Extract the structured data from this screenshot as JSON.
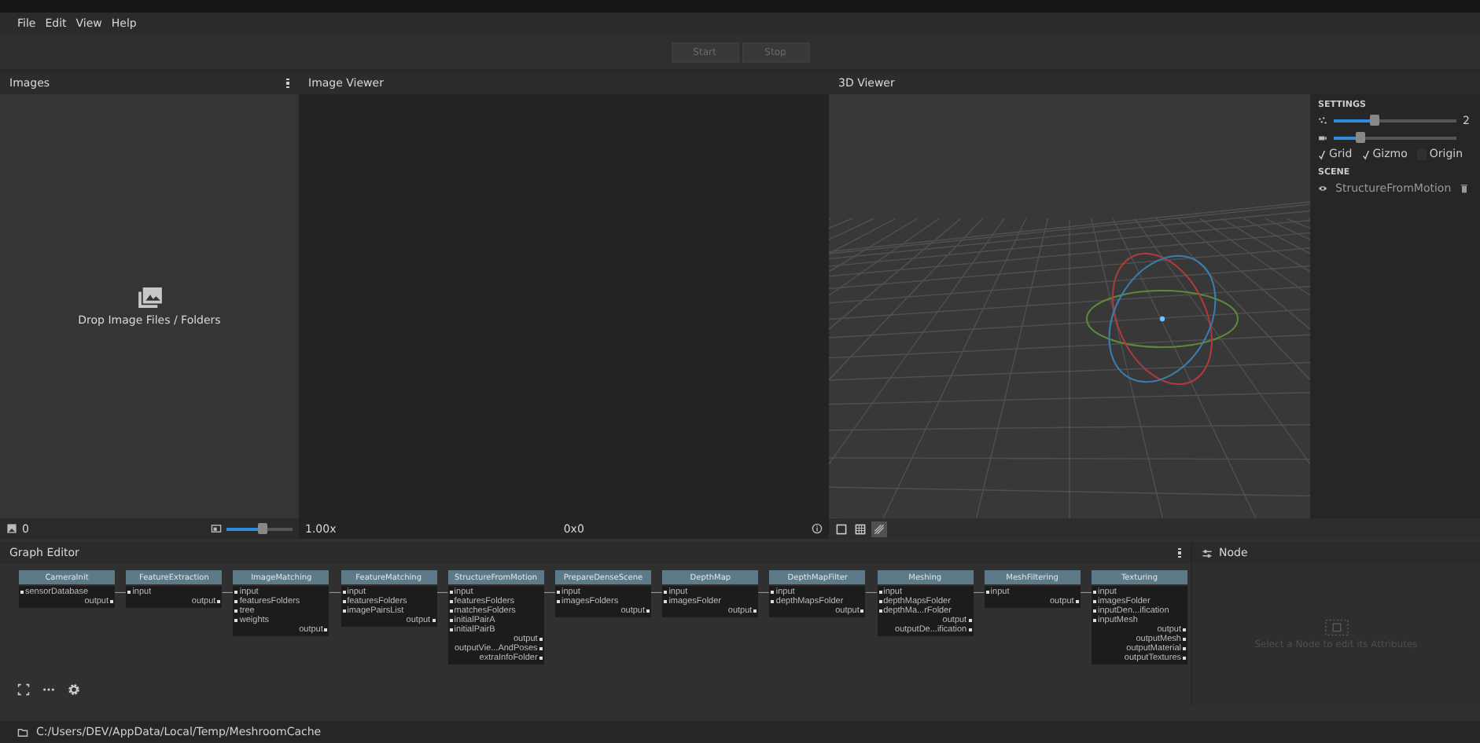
{
  "menu": [
    "File",
    "Edit",
    "View",
    "Help"
  ],
  "toolbar": [
    {
      "label": "Start",
      "disabled": true
    },
    {
      "label": "Stop",
      "disabled": true
    }
  ],
  "images_panel": {
    "title": "Images",
    "drop_hint": "Drop Image Files / Folders",
    "count": "0",
    "thumbnail_size": {
      "level": 0.55
    }
  },
  "image_viewer": {
    "title": "Image Viewer",
    "zoom": "1.00x",
    "resolution": "0x0"
  },
  "viewer_3d": {
    "title": "3D Viewer",
    "settings": {
      "title": "SETTINGS",
      "sliders": [
        {
          "kind": "points",
          "level": 0.33,
          "value": "2"
        },
        {
          "kind": "camera",
          "level": 0.22
        }
      ],
      "toggles": [
        {
          "label": "Grid",
          "checked": true
        },
        {
          "label": "Gizmo",
          "checked": true
        },
        {
          "label": "Origin",
          "checked": false
        }
      ],
      "scene_title": "SCENE",
      "scene_items": [
        {
          "label": "StructureFromMotion",
          "visible": true
        }
      ]
    },
    "view_modes": [
      {
        "kind": "solid",
        "selected": false
      },
      {
        "kind": "wireframe",
        "selected": false
      },
      {
        "kind": "textured",
        "selected": true
      }
    ]
  },
  "graph_editor": {
    "title": "Graph Editor",
    "nodes": [
      {
        "title": "CameraInit",
        "inputs": [
          "sensorDatabase"
        ],
        "outputs": [
          "output"
        ]
      },
      {
        "title": "FeatureExtraction",
        "inputs": [
          "input"
        ],
        "outputs": [
          "output"
        ]
      },
      {
        "title": "ImageMatching",
        "inputs": [
          "input",
          "featuresFolders",
          "tree",
          "weights"
        ],
        "outputs": [
          "output"
        ]
      },
      {
        "title": "FeatureMatching",
        "inputs": [
          "input",
          "featuresFolders",
          "imagePairsList"
        ],
        "outputs": [
          "output"
        ]
      },
      {
        "title": "StructureFromMotion",
        "inputs": [
          "input",
          "featuresFolders",
          "matchesFolders",
          "initialPairA",
          "initialPairB"
        ],
        "outputs": [
          "output",
          "outputVie...AndPoses",
          "extraInfoFolder"
        ]
      },
      {
        "title": "PrepareDenseScene",
        "inputs": [
          "input",
          "imagesFolders"
        ],
        "outputs": [
          "output"
        ]
      },
      {
        "title": "DepthMap",
        "inputs": [
          "input",
          "imagesFolder"
        ],
        "outputs": [
          "output"
        ]
      },
      {
        "title": "DepthMapFilter",
        "inputs": [
          "input",
          "depthMapsFolder"
        ],
        "outputs": [
          "output"
        ]
      },
      {
        "title": "Meshing",
        "inputs": [
          "input",
          "depthMapsFolder",
          "depthMa...rFolder"
        ],
        "outputs": [
          "output",
          "outputDe...ification"
        ]
      },
      {
        "title": "MeshFiltering",
        "inputs": [
          "input"
        ],
        "outputs": [
          "output"
        ]
      },
      {
        "title": "Texturing",
        "inputs": [
          "input",
          "imagesFolder",
          "inputDen...ification",
          "inputMesh"
        ],
        "outputs": [
          "output",
          "outputMesh",
          "outputMaterial",
          "outputTextures"
        ]
      }
    ]
  },
  "node_panel": {
    "title": "Node",
    "hint": "Select a Node to edit its Attributes"
  },
  "status_bar": {
    "path": "C:/Users/DEV/AppData/Local/Temp/MeshroomCache"
  }
}
